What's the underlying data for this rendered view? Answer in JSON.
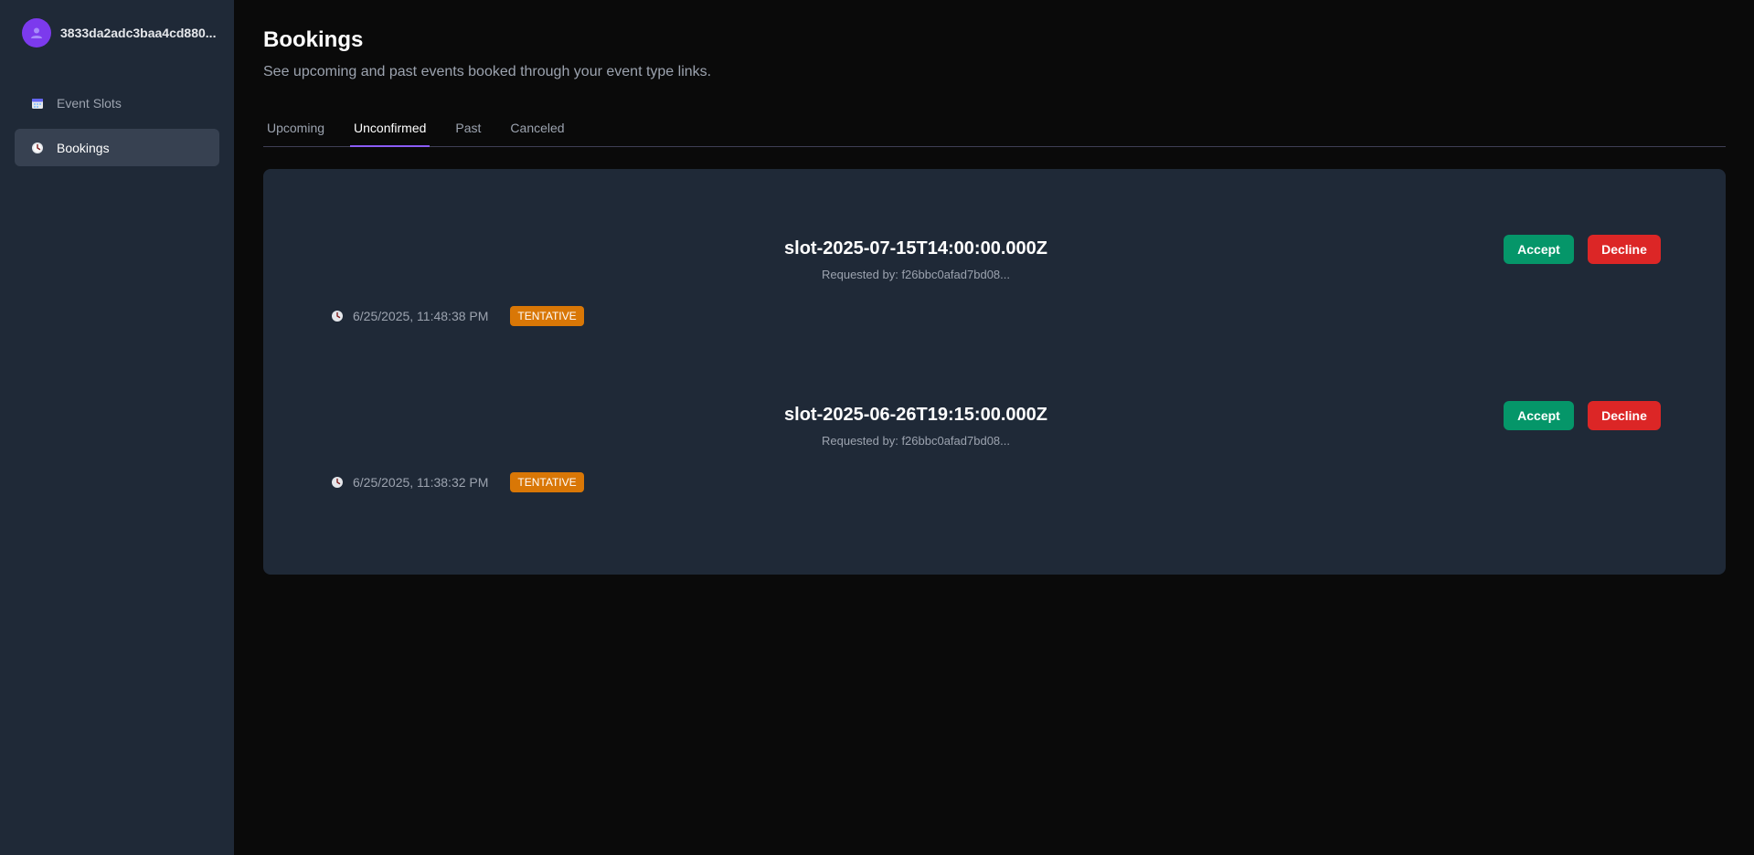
{
  "sidebar": {
    "username": "3833da2adc3baa4cd880...",
    "items": [
      {
        "label": "Event Slots",
        "icon": "calendar-icon"
      },
      {
        "label": "Bookings",
        "icon": "clock-icon"
      }
    ]
  },
  "header": {
    "title": "Bookings",
    "subtitle": "See upcoming and past events booked through your event type links."
  },
  "tabs": [
    {
      "label": "Upcoming",
      "active": false
    },
    {
      "label": "Unconfirmed",
      "active": true
    },
    {
      "label": "Past",
      "active": false
    },
    {
      "label": "Canceled",
      "active": false
    }
  ],
  "bookings": [
    {
      "slot": "slot-2025-07-15T14:00:00.000Z",
      "requested_by": "Requested by: f26bbc0afad7bd08...",
      "timestamp": "6/25/2025, 11:48:38 PM",
      "status": "TENTATIVE",
      "accept_label": "Accept",
      "decline_label": "Decline"
    },
    {
      "slot": "slot-2025-06-26T19:15:00.000Z",
      "requested_by": "Requested by: f26bbc0afad7bd08...",
      "timestamp": "6/25/2025, 11:38:32 PM",
      "status": "TENTATIVE",
      "accept_label": "Accept",
      "decline_label": "Decline"
    }
  ],
  "colors": {
    "sidebar_bg": "#1f2937",
    "accent": "#8b5cf6",
    "accept": "#059669",
    "decline": "#dc2626",
    "badge": "#d97706"
  }
}
